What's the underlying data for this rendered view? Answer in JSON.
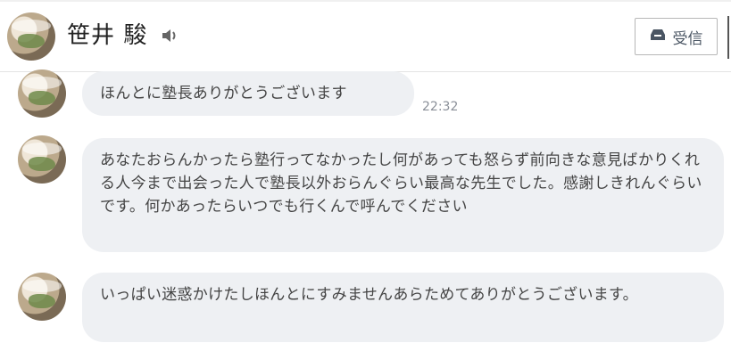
{
  "header": {
    "contact_name": "笹井 駿",
    "speaker_icon": "speaker-icon",
    "inbox_label": "受信",
    "inbox_icon": "inbox-icon"
  },
  "messages": [
    {
      "text": "ほんとに塾長ありがとうございます",
      "time": "22:32"
    },
    {
      "text": "あなたおらんかったら塾行ってなかったし何があっても怒らず前向きな意見ばかりくれる人今まで出会った人で塾長以外おらんぐらい最高な先生でした。感謝しきれんぐらいです。何かあったらいつでも行くんで呼んでください"
    },
    {
      "text": "いっぱい迷惑かけたしほんとにすみませんあらためてありがとうございます。"
    }
  ]
}
